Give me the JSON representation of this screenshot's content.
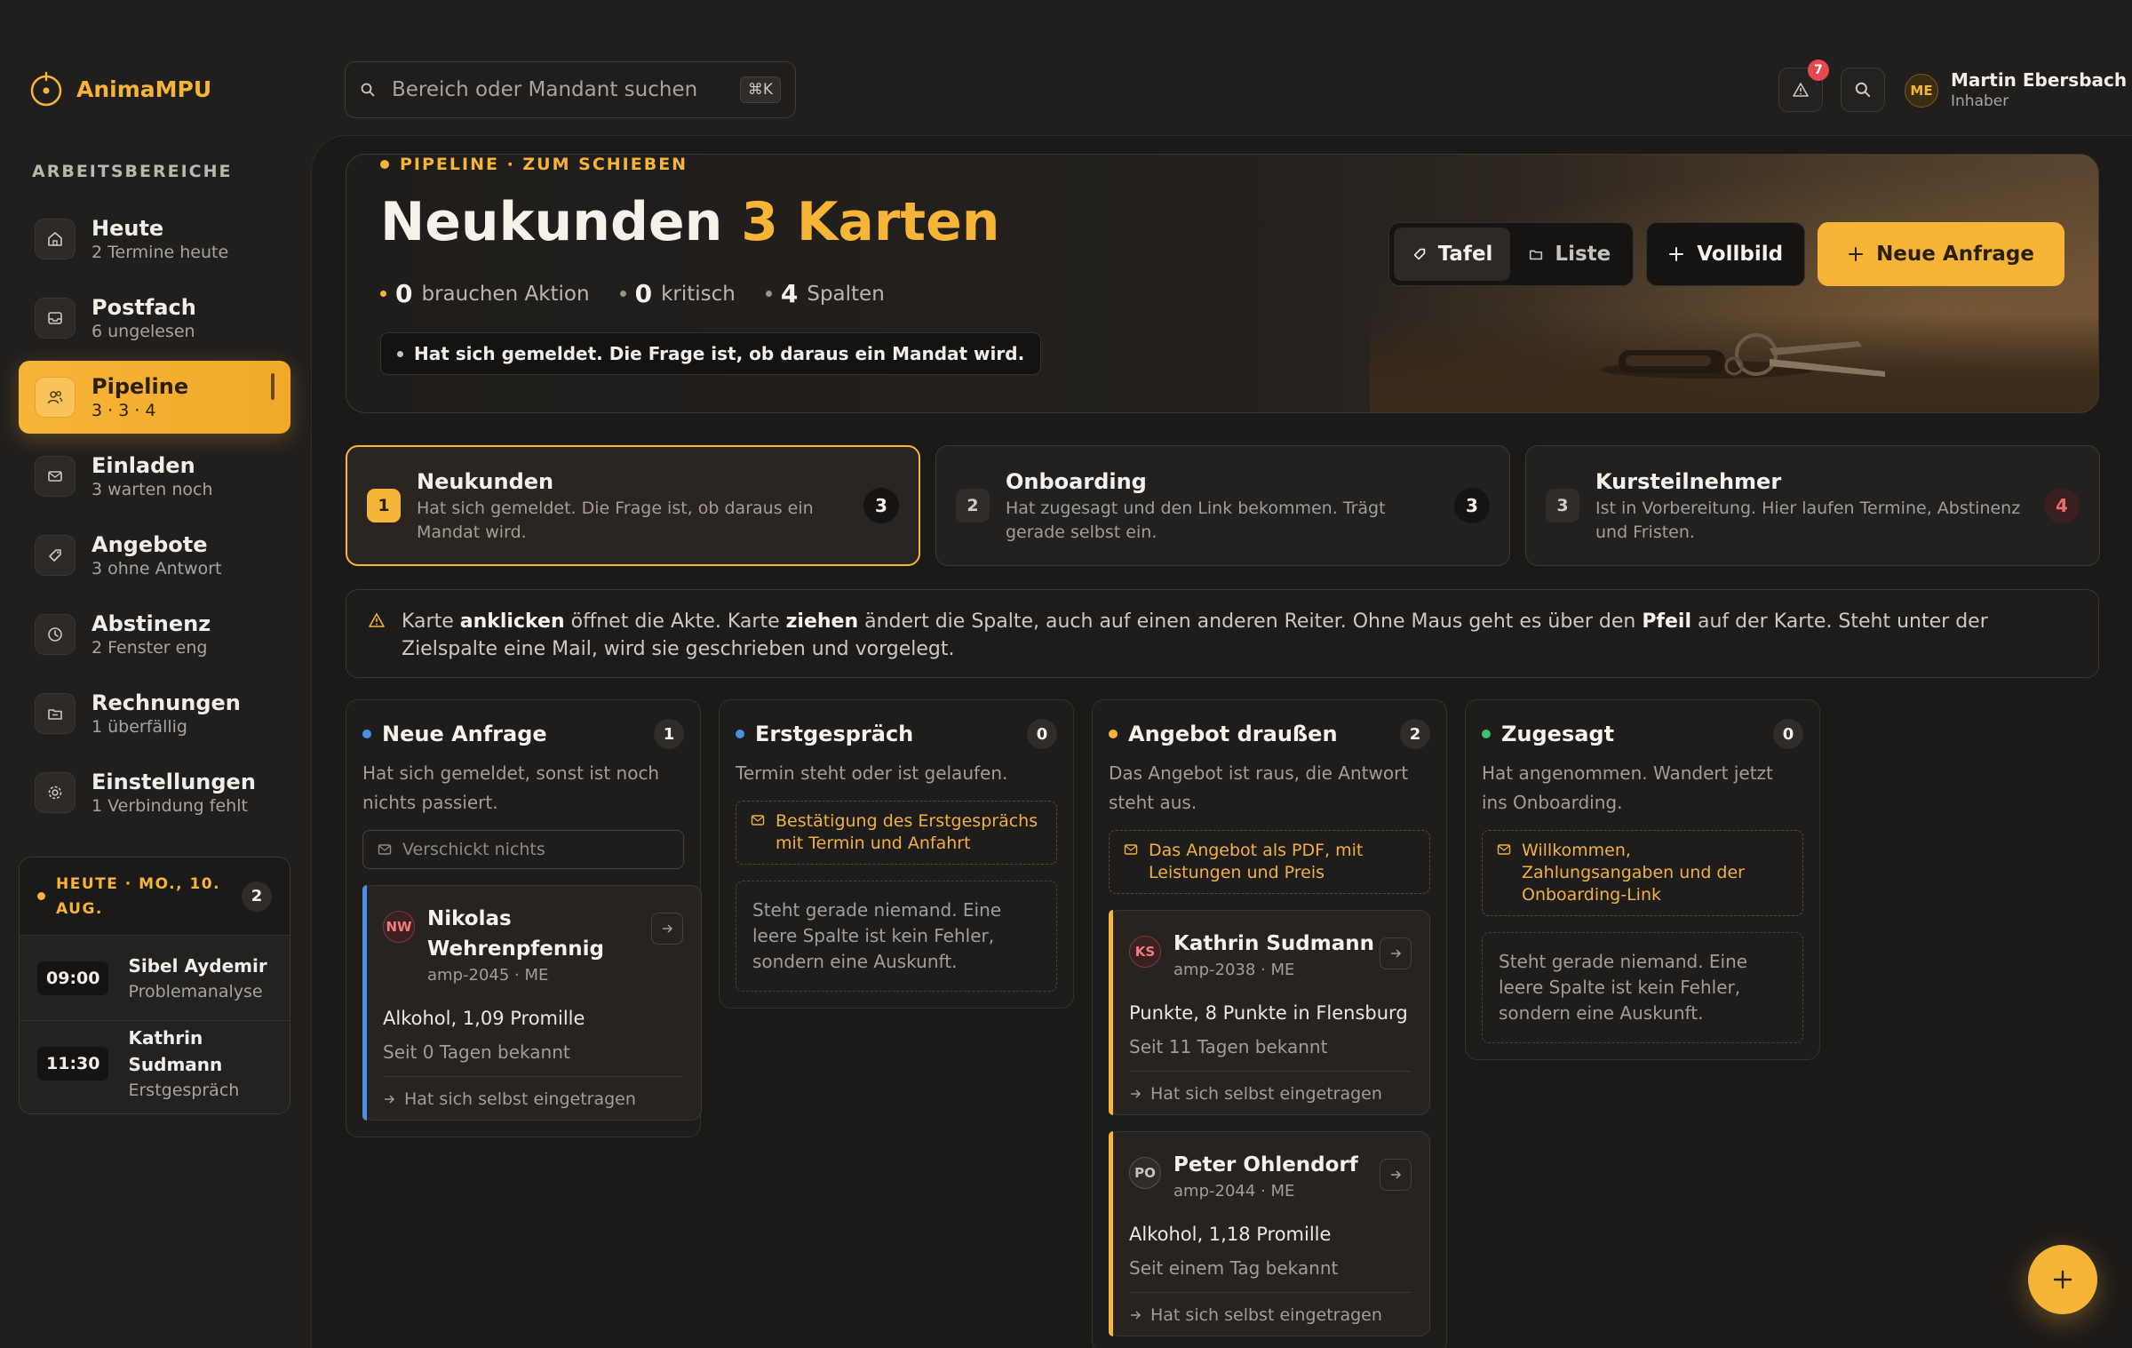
{
  "app": {
    "name": "AnimaMPU"
  },
  "sidebar": {
    "section_label": "ARBEITSBEREICHE",
    "items": [
      {
        "label": "Heute",
        "sub": "2 Termine heute",
        "icon": "home-icon"
      },
      {
        "label": "Postfach",
        "sub": "6 ungelesen",
        "icon": "inbox-icon"
      },
      {
        "label": "Pipeline",
        "sub": "3 · 3 · 4",
        "icon": "users-icon",
        "active": true
      },
      {
        "label": "Einladen",
        "sub": "3 warten noch",
        "icon": "mail-icon"
      },
      {
        "label": "Angebote",
        "sub": "3 ohne Antwort",
        "icon": "tag-icon"
      },
      {
        "label": "Abstinenz",
        "sub": "2 Fenster eng",
        "icon": "clock-icon"
      },
      {
        "label": "Rechnungen",
        "sub": "1 überfällig",
        "icon": "folder-icon"
      },
      {
        "label": "Einstellungen",
        "sub": "1 Verbindung fehlt",
        "icon": "gear-icon"
      }
    ],
    "today": {
      "title": "HEUTE · MO., 10. AUG.",
      "count": "2",
      "appointments": [
        {
          "time": "09:00",
          "name": "Sibel Aydemir",
          "type": "Problemanalyse"
        },
        {
          "time": "11:30",
          "name": "Kathrin Sudmann",
          "type": "Erstgespräch"
        }
      ]
    }
  },
  "topbar": {
    "search_placeholder": "Bereich oder Mandant suchen",
    "shortcut": "⌘K",
    "alert_count": "7",
    "user": {
      "initials": "ME",
      "name": "Martin Ebersbach",
      "role": "Inhaber"
    }
  },
  "hero": {
    "eyebrow": "PIPELINE · ZUM SCHIEBEN",
    "title": "Neukunden",
    "title_accent": "3 Karten",
    "stats": [
      {
        "value": "0",
        "label": "brauchen Aktion",
        "color": "#f7b538"
      },
      {
        "value": "0",
        "label": "kritisch",
        "color": "#9a9389"
      },
      {
        "value": "4",
        "label": "Spalten",
        "color": "#9a9389"
      }
    ],
    "note": "Hat sich gemeldet. Die Frage ist, ob daraus ein Mandat wird.",
    "view_board": "Tafel",
    "view_list": "Liste",
    "fullscreen": "Vollbild",
    "new_request": "Neue Anfrage"
  },
  "tabs": [
    {
      "num": "1",
      "title": "Neukunden",
      "desc": "Hat sich gemeldet. Die Frage ist, ob daraus ein Mandat wird.",
      "count": "3",
      "active": true
    },
    {
      "num": "2",
      "title": "Onboarding",
      "desc": "Hat zugesagt und den Link bekommen. Trägt gerade selbst ein.",
      "count": "3"
    },
    {
      "num": "3",
      "title": "Kursteilnehmer",
      "desc": "Ist in Vorbereitung. Hier laufen Termine, Abstinenz und Fristen.",
      "count": "4",
      "alert": true
    }
  ],
  "hint": {
    "p1": "Karte ",
    "b1": "anklicken",
    "p2": " öffnet die Akte. Karte ",
    "b2": "ziehen",
    "p3": " ändert die Spalte, auch auf einen anderen Reiter. Ohne Maus geht es über den ",
    "b3": "Pfeil",
    "p4": " auf der Karte. Steht unter der Zielspalte eine Mail, wird sie geschrieben und vorgelegt."
  },
  "columns": [
    {
      "title": "Neue Anfrage",
      "count": "1",
      "dot": "#4b8fe3",
      "desc": "Hat sich gemeldet, sonst ist noch nichts passiert.",
      "mail": "Verschickt nichts",
      "cards": [
        {
          "initials": "NW",
          "name": "Nikolas Wehrenpfennig",
          "id": "amp-2045 · ME",
          "fact": "Alkohol, 1,09 Promille",
          "since": "Seit 0 Tagen bekannt",
          "source": "Hat sich selbst eingetragen"
        }
      ]
    },
    {
      "title": "Erstgespräch",
      "count": "0",
      "dot": "#4b8fe3",
      "desc": "Termin steht oder ist gelaufen.",
      "mail": "Bestätigung des Erstgesprächs mit Termin und Anfahrt",
      "empty": "Steht gerade niemand. Eine leere Spalte ist kein Fehler, sondern eine Auskunft."
    },
    {
      "title": "Angebot draußen",
      "count": "2",
      "dot": "#f7b538",
      "desc": "Das Angebot ist raus, die Antwort steht aus.",
      "mail": "Das Angebot als PDF, mit Leistungen und Preis",
      "cards": [
        {
          "initials": "KS",
          "name": "Kathrin Sudmann",
          "id": "amp-2038 · ME",
          "fact": "Punkte, 8 Punkte in Flensburg",
          "since": "Seit 11 Tagen bekannt",
          "source": "Hat sich selbst eingetragen"
        },
        {
          "initials": "PO",
          "name": "Peter Ohlendorf",
          "id": "amp-2044 · ME",
          "fact": "Alkohol, 1,18 Promille",
          "since": "Seit einem Tag bekannt",
          "source": "Hat sich selbst eingetragen"
        }
      ]
    },
    {
      "title": "Zugesagt",
      "count": "0",
      "dot": "#3fbf6f",
      "desc": "Hat angenommen. Wandert jetzt ins Onboarding.",
      "mail": "Willkommen, Zahlungsangaben und der Onboarding-Link",
      "empty": "Steht gerade niemand. Eine leere Spalte ist kein Fehler, sondern eine Auskunft."
    }
  ],
  "colors": {
    "accent": "#f7b538",
    "background": "#211f1d",
    "danger": "#e5484d"
  }
}
